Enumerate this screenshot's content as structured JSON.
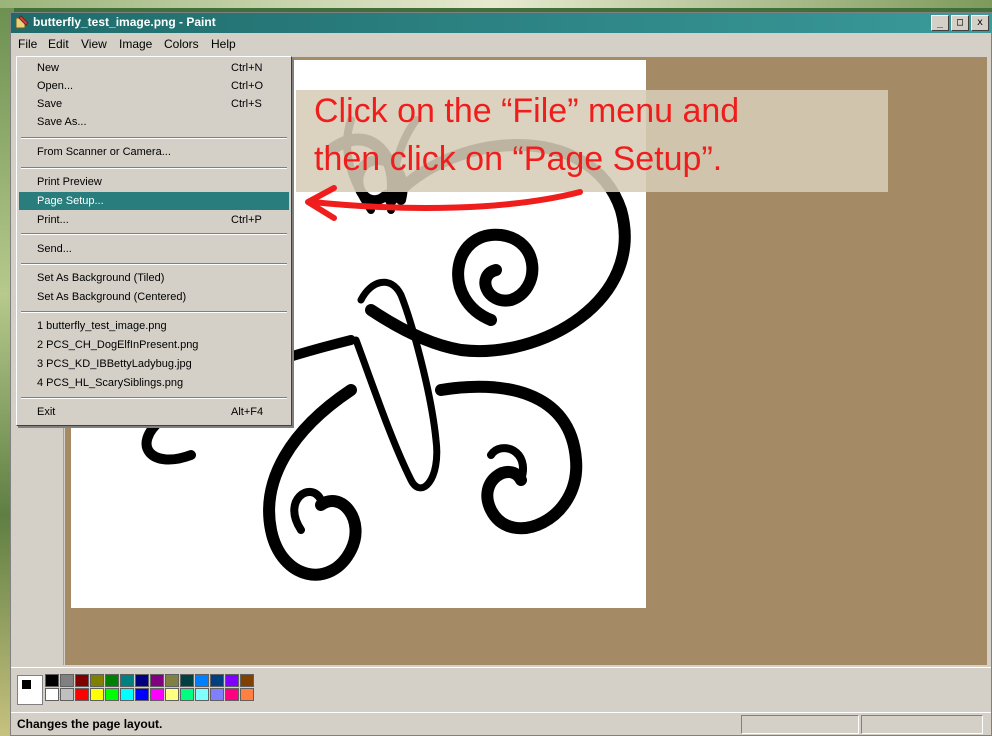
{
  "window": {
    "title": "butterfly_test_image.png - Paint",
    "buttons": [
      "_",
      "□",
      "x"
    ]
  },
  "menubar": [
    "File",
    "Edit",
    "View",
    "Image",
    "Colors",
    "Help"
  ],
  "file_menu": [
    {
      "label": "New",
      "shortcut": "Ctrl+N"
    },
    {
      "label": "Open...",
      "shortcut": "Ctrl+O"
    },
    {
      "label": "Save",
      "shortcut": "Ctrl+S"
    },
    {
      "label": "Save As...",
      "shortcut": ""
    },
    {
      "label": "From Scanner or Camera...",
      "shortcut": ""
    },
    {
      "label": "Print Preview",
      "shortcut": ""
    },
    {
      "label": "Page Setup...",
      "shortcut": "",
      "highlighted": true
    },
    {
      "label": "Print...",
      "shortcut": "Ctrl+P"
    },
    {
      "label": "Send...",
      "shortcut": ""
    },
    {
      "label": "Set As Background (Tiled)",
      "shortcut": ""
    },
    {
      "label": "Set As Background (Centered)",
      "shortcut": ""
    },
    {
      "label": "1 butterfly_test_image.png",
      "shortcut": ""
    },
    {
      "label": "2 PCS_CH_DogElfInPresent.png",
      "shortcut": ""
    },
    {
      "label": "3 PCS_KD_IBBettyLadybug.jpg",
      "shortcut": ""
    },
    {
      "label": "4 PCS_HL_ScarySiblings.png",
      "shortcut": ""
    },
    {
      "label": "Exit",
      "shortcut": "Alt+F4"
    }
  ],
  "callout": {
    "line1": "Click on the “File” menu and",
    "line2": "then click on “Page Setup”.",
    "color": "#f01d1d"
  },
  "palette": [
    "#000000",
    "#808080",
    "#800000",
    "#808000",
    "#008000",
    "#008080",
    "#000080",
    "#800080",
    "#808040",
    "#004040",
    "#0080ff",
    "#004080",
    "#8000ff",
    "#804000",
    "#ffffff",
    "#c0c0c0",
    "#ff0000",
    "#ffff00",
    "#00ff00",
    "#00ffff",
    "#0000ff",
    "#ff00ff",
    "#ffff80",
    "#00ff80",
    "#80ffff",
    "#8080ff",
    "#ff0080",
    "#ff8040"
  ],
  "status": {
    "text": "Changes the page layout."
  },
  "colors": {
    "titlebar": "#1f6b6b",
    "workspace": "#a48a65",
    "highlight": "#297d7d"
  }
}
